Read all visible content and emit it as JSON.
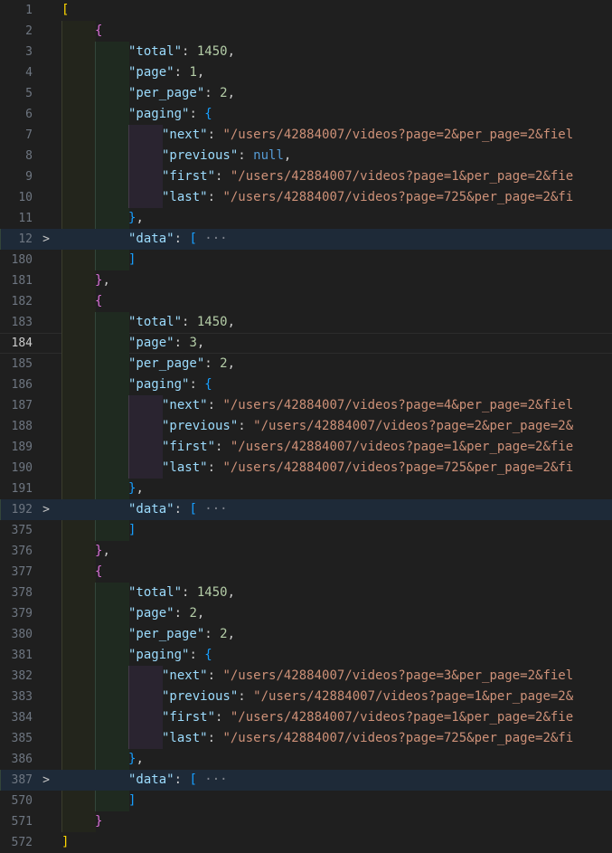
{
  "editor": {
    "lines": [
      {
        "n": "1",
        "ind": 0,
        "tokens": [
          [
            "y",
            "["
          ]
        ]
      },
      {
        "n": "2",
        "ind": 1,
        "tokens": [
          [
            "p",
            "{"
          ]
        ]
      },
      {
        "n": "3",
        "ind": 2,
        "tokens": [
          [
            "k",
            "\"total\""
          ],
          [
            "t",
            ": "
          ],
          [
            "n",
            "1450"
          ],
          [
            "t",
            ","
          ]
        ]
      },
      {
        "n": "4",
        "ind": 2,
        "tokens": [
          [
            "k",
            "\"page\""
          ],
          [
            "t",
            ": "
          ],
          [
            "n",
            "1"
          ],
          [
            "t",
            ","
          ]
        ]
      },
      {
        "n": "5",
        "ind": 2,
        "tokens": [
          [
            "k",
            "\"per_page\""
          ],
          [
            "t",
            ": "
          ],
          [
            "n",
            "2"
          ],
          [
            "t",
            ","
          ]
        ]
      },
      {
        "n": "6",
        "ind": 2,
        "tokens": [
          [
            "k",
            "\"paging\""
          ],
          [
            "t",
            ": "
          ],
          [
            "b",
            "{"
          ]
        ]
      },
      {
        "n": "7",
        "ind": 3,
        "tokens": [
          [
            "k",
            "\"next\""
          ],
          [
            "t",
            ": "
          ],
          [
            "s",
            "\"/users/42884007/videos?page=2&per_page=2&fiel"
          ]
        ]
      },
      {
        "n": "8",
        "ind": 3,
        "tokens": [
          [
            "k",
            "\"previous\""
          ],
          [
            "t",
            ": "
          ],
          [
            "w",
            "null"
          ],
          [
            "t",
            ","
          ]
        ]
      },
      {
        "n": "9",
        "ind": 3,
        "tokens": [
          [
            "k",
            "\"first\""
          ],
          [
            "t",
            ": "
          ],
          [
            "s",
            "\"/users/42884007/videos?page=1&per_page=2&fie"
          ]
        ]
      },
      {
        "n": "10",
        "ind": 3,
        "tokens": [
          [
            "k",
            "\"last\""
          ],
          [
            "t",
            ": "
          ],
          [
            "s",
            "\"/users/42884007/videos?page=725&per_page=2&fi"
          ]
        ]
      },
      {
        "n": "11",
        "ind": 2,
        "tokens": [
          [
            "b",
            "}"
          ],
          [
            "t",
            ","
          ]
        ]
      },
      {
        "n": "12",
        "ind": 2,
        "fold": true,
        "tokens": [
          [
            "k",
            "\"data\""
          ],
          [
            "t",
            ": "
          ],
          [
            "b",
            "["
          ],
          [
            "e",
            " ···"
          ]
        ]
      },
      {
        "n": "180",
        "ind": 2,
        "tokens": [
          [
            "b",
            "]"
          ]
        ]
      },
      {
        "n": "181",
        "ind": 1,
        "tokens": [
          [
            "p",
            "}"
          ],
          [
            "t",
            ","
          ]
        ]
      },
      {
        "n": "182",
        "ind": 1,
        "tokens": [
          [
            "p",
            "{"
          ]
        ]
      },
      {
        "n": "183",
        "ind": 2,
        "tokens": [
          [
            "k",
            "\"total\""
          ],
          [
            "t",
            ": "
          ],
          [
            "n",
            "1450"
          ],
          [
            "t",
            ","
          ]
        ]
      },
      {
        "n": "184",
        "ind": 2,
        "current": true,
        "tokens": [
          [
            "k",
            "\"page\""
          ],
          [
            "t",
            ": "
          ],
          [
            "n",
            "3"
          ],
          [
            "t",
            ","
          ]
        ]
      },
      {
        "n": "185",
        "ind": 2,
        "tokens": [
          [
            "k",
            "\"per_page\""
          ],
          [
            "t",
            ": "
          ],
          [
            "n",
            "2"
          ],
          [
            "t",
            ","
          ]
        ]
      },
      {
        "n": "186",
        "ind": 2,
        "tokens": [
          [
            "k",
            "\"paging\""
          ],
          [
            "t",
            ": "
          ],
          [
            "b",
            "{"
          ]
        ]
      },
      {
        "n": "187",
        "ind": 3,
        "tokens": [
          [
            "k",
            "\"next\""
          ],
          [
            "t",
            ": "
          ],
          [
            "s",
            "\"/users/42884007/videos?page=4&per_page=2&fiel"
          ]
        ]
      },
      {
        "n": "188",
        "ind": 3,
        "tokens": [
          [
            "k",
            "\"previous\""
          ],
          [
            "t",
            ": "
          ],
          [
            "s",
            "\"/users/42884007/videos?page=2&per_page=2&"
          ]
        ]
      },
      {
        "n": "189",
        "ind": 3,
        "tokens": [
          [
            "k",
            "\"first\""
          ],
          [
            "t",
            ": "
          ],
          [
            "s",
            "\"/users/42884007/videos?page=1&per_page=2&fie"
          ]
        ]
      },
      {
        "n": "190",
        "ind": 3,
        "tokens": [
          [
            "k",
            "\"last\""
          ],
          [
            "t",
            ": "
          ],
          [
            "s",
            "\"/users/42884007/videos?page=725&per_page=2&fi"
          ]
        ]
      },
      {
        "n": "191",
        "ind": 2,
        "tokens": [
          [
            "b",
            "}"
          ],
          [
            "t",
            ","
          ]
        ]
      },
      {
        "n": "192",
        "ind": 2,
        "fold": true,
        "tokens": [
          [
            "k",
            "\"data\""
          ],
          [
            "t",
            ": "
          ],
          [
            "b",
            "["
          ],
          [
            "e",
            " ···"
          ]
        ]
      },
      {
        "n": "375",
        "ind": 2,
        "tokens": [
          [
            "b",
            "]"
          ]
        ]
      },
      {
        "n": "376",
        "ind": 1,
        "tokens": [
          [
            "p",
            "}"
          ],
          [
            "t",
            ","
          ]
        ]
      },
      {
        "n": "377",
        "ind": 1,
        "tokens": [
          [
            "p",
            "{"
          ]
        ]
      },
      {
        "n": "378",
        "ind": 2,
        "tokens": [
          [
            "k",
            "\"total\""
          ],
          [
            "t",
            ": "
          ],
          [
            "n",
            "1450"
          ],
          [
            "t",
            ","
          ]
        ]
      },
      {
        "n": "379",
        "ind": 2,
        "tokens": [
          [
            "k",
            "\"page\""
          ],
          [
            "t",
            ": "
          ],
          [
            "n",
            "2"
          ],
          [
            "t",
            ","
          ]
        ]
      },
      {
        "n": "380",
        "ind": 2,
        "tokens": [
          [
            "k",
            "\"per_page\""
          ],
          [
            "t",
            ": "
          ],
          [
            "n",
            "2"
          ],
          [
            "t",
            ","
          ]
        ]
      },
      {
        "n": "381",
        "ind": 2,
        "tokens": [
          [
            "k",
            "\"paging\""
          ],
          [
            "t",
            ": "
          ],
          [
            "b",
            "{"
          ]
        ]
      },
      {
        "n": "382",
        "ind": 3,
        "tokens": [
          [
            "k",
            "\"next\""
          ],
          [
            "t",
            ": "
          ],
          [
            "s",
            "\"/users/42884007/videos?page=3&per_page=2&fiel"
          ]
        ]
      },
      {
        "n": "383",
        "ind": 3,
        "tokens": [
          [
            "k",
            "\"previous\""
          ],
          [
            "t",
            ": "
          ],
          [
            "s",
            "\"/users/42884007/videos?page=1&per_page=2&"
          ]
        ]
      },
      {
        "n": "384",
        "ind": 3,
        "tokens": [
          [
            "k",
            "\"first\""
          ],
          [
            "t",
            ": "
          ],
          [
            "s",
            "\"/users/42884007/videos?page=1&per_page=2&fie"
          ]
        ]
      },
      {
        "n": "385",
        "ind": 3,
        "tokens": [
          [
            "k",
            "\"last\""
          ],
          [
            "t",
            ": "
          ],
          [
            "s",
            "\"/users/42884007/videos?page=725&per_page=2&fi"
          ]
        ]
      },
      {
        "n": "386",
        "ind": 2,
        "tokens": [
          [
            "b",
            "}"
          ],
          [
            "t",
            ","
          ]
        ]
      },
      {
        "n": "387",
        "ind": 2,
        "fold": true,
        "tokens": [
          [
            "k",
            "\"data\""
          ],
          [
            "t",
            ": "
          ],
          [
            "b",
            "["
          ],
          [
            "e",
            " ···"
          ]
        ]
      },
      {
        "n": "570",
        "ind": 2,
        "tokens": [
          [
            "b",
            "]"
          ]
        ]
      },
      {
        "n": "571",
        "ind": 1,
        "tokens": [
          [
            "p",
            "}"
          ]
        ]
      },
      {
        "n": "572",
        "ind": 0,
        "tokens": [
          [
            "y",
            "]"
          ]
        ]
      }
    ],
    "fold_icon": "chevron-right-icon",
    "fold_glyph": ">"
  }
}
